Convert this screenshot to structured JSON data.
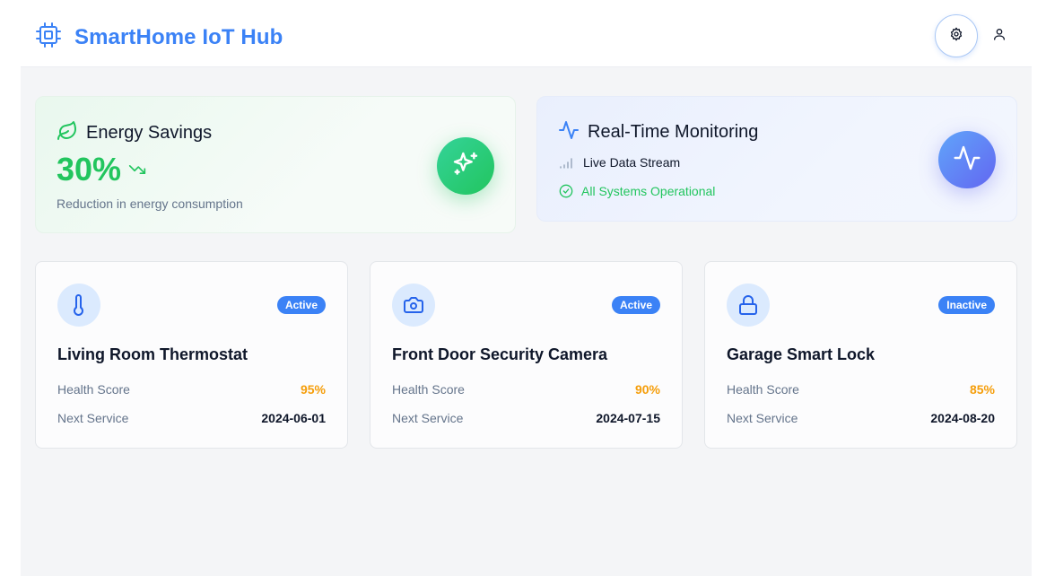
{
  "header": {
    "title": "SmartHome IoT Hub",
    "brand_icon": "chip-icon",
    "settings_icon": "gear-icon",
    "user_icon": "user-icon"
  },
  "energy": {
    "title": "Energy Savings",
    "value": "30%",
    "description": "Reduction in energy consumption",
    "icon": "leaf-icon",
    "trend_icon": "trending-down-icon",
    "action_icon": "sparkles-icon",
    "accent": "#22c55e"
  },
  "monitoring": {
    "title": "Real-Time Monitoring",
    "stream_label": "Live Data Stream",
    "status_label": "All Systems Operational",
    "icon": "activity-icon",
    "signal_icon": "signal-icon",
    "status_icon": "check-circle-icon",
    "accent": "#3b82f6"
  },
  "labels": {
    "health": "Health Score",
    "service": "Next Service"
  },
  "devices": [
    {
      "name": "Living Room Thermostat",
      "status": "Active",
      "health": "95%",
      "next_service": "2024-06-01",
      "icon": "thermometer-icon"
    },
    {
      "name": "Front Door Security Camera",
      "status": "Active",
      "health": "90%",
      "next_service": "2024-07-15",
      "icon": "camera-icon"
    },
    {
      "name": "Garage Smart Lock",
      "status": "Inactive",
      "health": "85%",
      "next_service": "2024-08-20",
      "icon": "lock-icon"
    }
  ],
  "colors": {
    "primary": "#3b82f6",
    "success": "#22c55e",
    "warning": "#f59e0b",
    "background": "#f4f5f7"
  }
}
